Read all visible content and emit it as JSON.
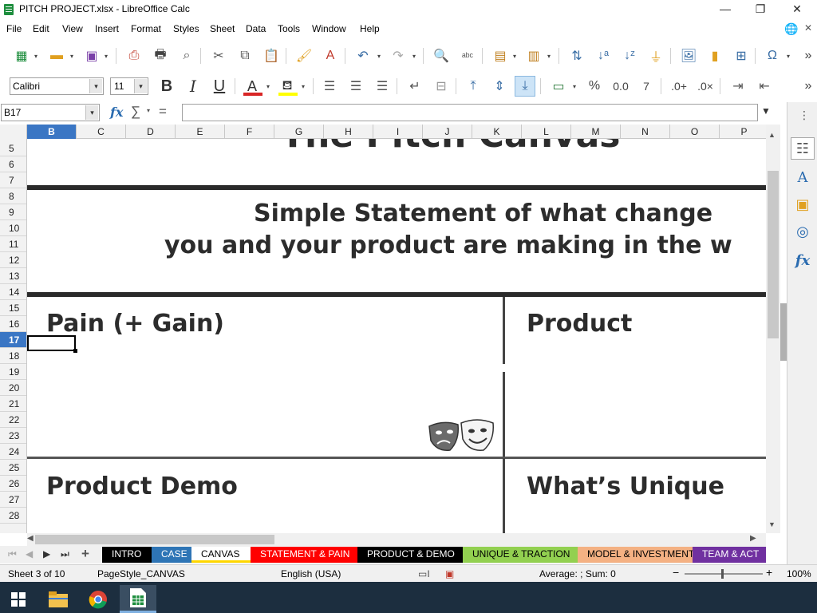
{
  "window": {
    "title": "PITCH  PROJECT.xlsx - LibreOffice Calc",
    "minimize": "—",
    "restore": "❐",
    "close": "✕"
  },
  "menubar": {
    "items": [
      {
        "label": "File"
      },
      {
        "label": "Edit"
      },
      {
        "label": "View"
      },
      {
        "label": "Insert"
      },
      {
        "label": "Format"
      },
      {
        "label": "Styles"
      },
      {
        "label": "Sheet"
      },
      {
        "label": "Data"
      },
      {
        "label": "Tools"
      },
      {
        "label": "Window"
      },
      {
        "label": "Help"
      }
    ],
    "close_doc": "✕"
  },
  "formatting": {
    "font_name": "Calibri",
    "font_size": "11",
    "font_color": "#d92626",
    "highlight_color": "#ffff00"
  },
  "formula_bar": {
    "cell_ref": "B17",
    "formula": ""
  },
  "grid": {
    "columns": [
      "B",
      "C",
      "D",
      "E",
      "F",
      "G",
      "H",
      "I",
      "J",
      "K",
      "L",
      "M",
      "N",
      "O",
      "P"
    ],
    "active_column": "B",
    "rows": [
      "5",
      "6",
      "7",
      "8",
      "9",
      "10",
      "11",
      "12",
      "13",
      "14",
      "15",
      "16",
      "17",
      "18",
      "19",
      "20",
      "21",
      "22",
      "23",
      "24",
      "25",
      "26",
      "27",
      "28"
    ],
    "active_row": "17"
  },
  "canvas": {
    "top_title": "The Pitch Canvas",
    "statement_line1": "Simple Statement of what change",
    "statement_line2": "you and your product are making in the w",
    "pain_label": "Pain (+ Gain)",
    "product_label": "Product",
    "demo_label": "Product Demo",
    "unique_label": "What’s Unique"
  },
  "sheet_tabs": [
    {
      "label": "INTRO",
      "bg": "#000000",
      "fg": "#ffffff"
    },
    {
      "label": "CASE",
      "bg": "#2e75b6",
      "fg": "#ffffff"
    },
    {
      "label": "CANVAS",
      "bg": "#ffffff",
      "fg": "#000000",
      "active": true
    },
    {
      "label": "STATEMENT & PAIN",
      "bg": "#ff0000",
      "fg": "#ffffff"
    },
    {
      "label": "PRODUCT & DEMO",
      "bg": "#000000",
      "fg": "#ffffff"
    },
    {
      "label": "UNIQUE & TRACTION",
      "bg": "#92d050",
      "fg": "#000000"
    },
    {
      "label": "MODEL & INVESTMENT",
      "bg": "#f4b183",
      "fg": "#000000"
    },
    {
      "label": "TEAM & ACT",
      "bg": "#7030a0",
      "fg": "#ffffff"
    }
  ],
  "statusbar": {
    "sheet_info": "Sheet 3 of 10",
    "page_style": "PageStyle_CANVAS",
    "language": "English (USA)",
    "summary": "Average: ; Sum: 0",
    "zoom": "100%",
    "zoom_minus": "−",
    "zoom_plus": "+"
  }
}
